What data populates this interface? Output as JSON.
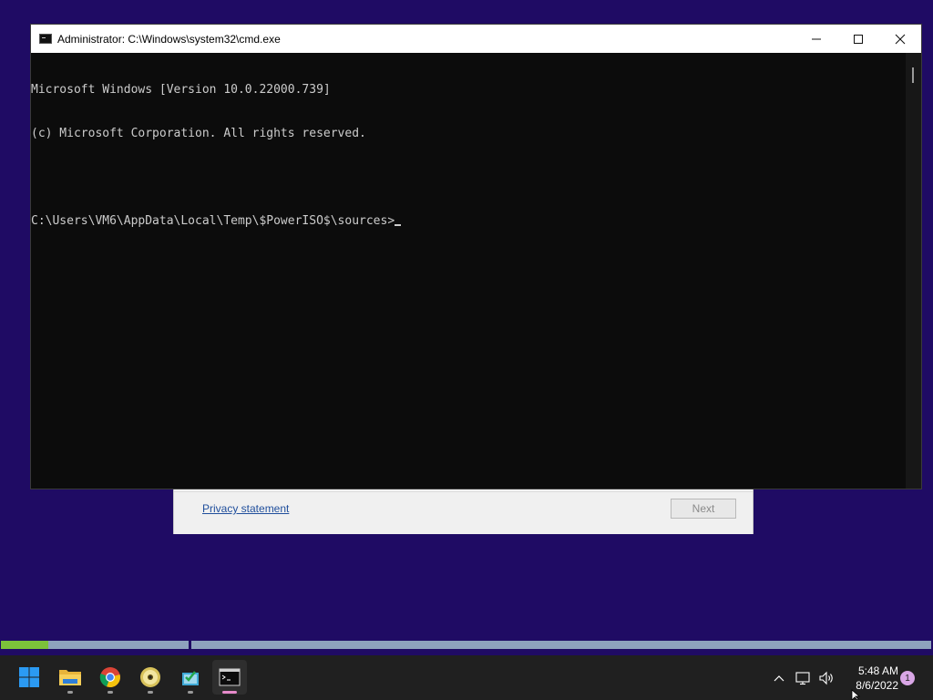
{
  "setup_dialog": {
    "privacy_label": "Privacy statement",
    "next_label": "Next"
  },
  "cmd": {
    "title": "Administrator: C:\\Windows\\system32\\cmd.exe",
    "lines": [
      "Microsoft Windows [Version 10.0.22000.739]",
      "(c) Microsoft Corporation. All rights reserved.",
      "",
      "C:\\Users\\VM6\\AppData\\Local\\Temp\\$PowerISO$\\sources>"
    ]
  },
  "progress": {
    "segment1_fill_fraction": 0.25
  },
  "taskbar": {
    "apps": [
      {
        "name": "start-button",
        "icon": "windows-logo-icon"
      },
      {
        "name": "file-explorer",
        "icon": "folder-icon"
      },
      {
        "name": "chrome",
        "icon": "chrome-icon"
      },
      {
        "name": "poweriso",
        "icon": "disc-icon"
      },
      {
        "name": "setup-app",
        "icon": "setup-icon"
      },
      {
        "name": "command-prompt",
        "icon": "terminal-icon",
        "active": true
      }
    ],
    "time": "5:48 AM",
    "date": "8/6/2022",
    "notification_count": "1"
  },
  "colors": {
    "desktop": "#1f0b64",
    "console_bg": "#0c0c0c",
    "console_text": "#cccccc",
    "progress_fill": "#7cc23a",
    "progress_track": "#8ea2bd",
    "taskbar": "#202020",
    "active_indicator": "#e68acb"
  }
}
